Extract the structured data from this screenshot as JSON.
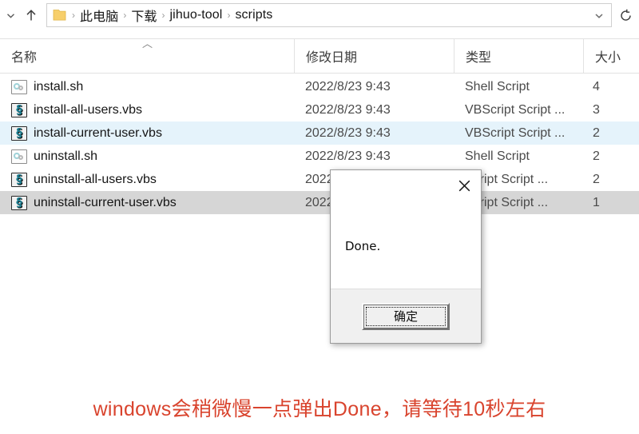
{
  "addressbar": {
    "back_icon": "chevron-down-icon",
    "up_icon": "up-arrow-icon",
    "folder_icon": "folder-icon",
    "dropdown_icon": "chevron-down-icon",
    "refresh_icon": "refresh-icon",
    "separator": "›",
    "breadcrumbs": [
      {
        "label": "此电脑"
      },
      {
        "label": "下载"
      },
      {
        "label": "jihuo-tool"
      },
      {
        "label": "scripts"
      }
    ]
  },
  "columns": [
    {
      "key": "name",
      "label": "名称",
      "sort": "asc",
      "sort_caret": "︿"
    },
    {
      "key": "date",
      "label": "修改日期"
    },
    {
      "key": "type",
      "label": "类型"
    },
    {
      "key": "size",
      "label": "大小"
    }
  ],
  "files": [
    {
      "name": "install.sh",
      "date": "2022/8/23 9:43",
      "type": "Shell Script",
      "size": "4",
      "icon": "shell-script-icon",
      "state": "normal"
    },
    {
      "name": "install-all-users.vbs",
      "date": "2022/8/23 9:43",
      "type": "VBScript Script ...",
      "size": "3",
      "icon": "vbscript-file-icon",
      "state": "normal"
    },
    {
      "name": "install-current-user.vbs",
      "date": "2022/8/23 9:43",
      "type": "VBScript Script ...",
      "size": "2",
      "icon": "vbscript-file-icon",
      "state": "selected"
    },
    {
      "name": "uninstall.sh",
      "date": "2022/8/23 9:43",
      "type": "Shell Script",
      "size": "2",
      "icon": "shell-script-icon",
      "state": "normal"
    },
    {
      "name": "uninstall-all-users.vbs",
      "date": "2022",
      "type": "Script Script ...",
      "size": "2",
      "icon": "vbscript-file-icon",
      "state": "normal"
    },
    {
      "name": "uninstall-current-user.vbs",
      "date": "2022",
      "type": "Script Script ...",
      "size": "1",
      "icon": "vbscript-file-icon",
      "state": "selected-gray"
    }
  ],
  "dialog": {
    "message": "Done.",
    "close_icon": "close-icon",
    "ok_label": "确定"
  },
  "annotation": {
    "text": "windows会稍微慢一点弹出Done，请等待10秒左右",
    "color": "#d9442e"
  }
}
